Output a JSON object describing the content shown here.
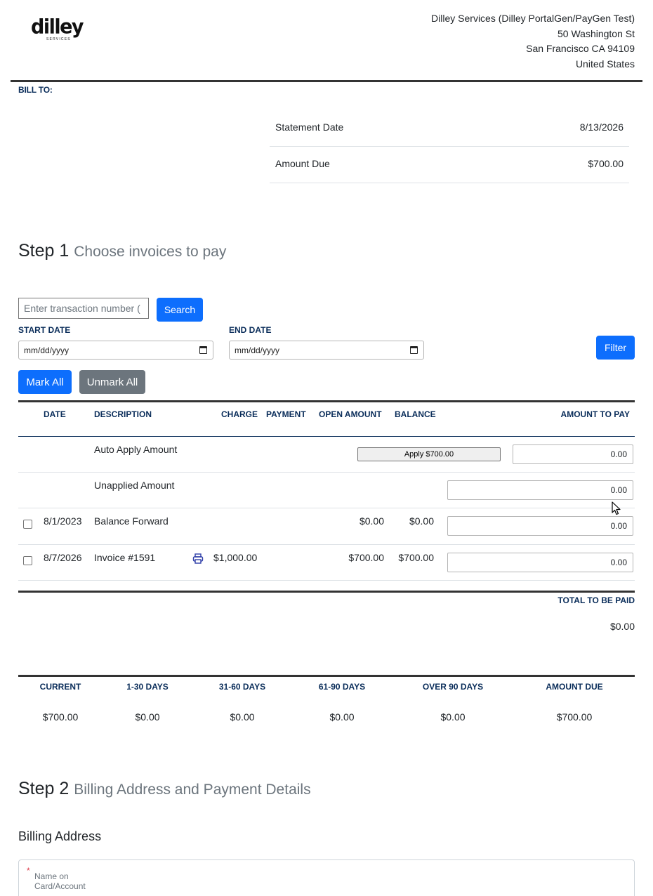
{
  "header": {
    "logo_text": "dilley",
    "logo_sub": "SERVICES",
    "company_lines": [
      "Dilley Services (Dilley PortalGen/PayGen Test)",
      "50 Washington St",
      "San Francisco CA 94109",
      "United States"
    ],
    "bill_to": "BILL TO:"
  },
  "statement": {
    "date_label": "Statement Date",
    "date_value": "8/13/2026",
    "due_label": "Amount Due",
    "due_value": "$700.00"
  },
  "step1": {
    "step": "Step 1",
    "title": "Choose invoices to pay",
    "search_placeholder": "Enter transaction number (",
    "search_button": "Search",
    "start_date_label": "START DATE",
    "end_date_label": "END DATE",
    "date_placeholder": "mm/dd/yyyy",
    "filter_button": "Filter",
    "mark_all": "Mark All",
    "unmark_all": "Unmark All"
  },
  "table": {
    "headers": [
      "DATE",
      "DESCRIPTION",
      "CHARGE",
      "PAYMENT",
      "OPEN AMOUNT",
      "BALANCE",
      "AMOUNT TO PAY"
    ],
    "auto_apply_label": "Auto Apply Amount",
    "apply_button": "Apply $700.00",
    "auto_apply_value": "0.00",
    "unapplied_label": "Unapplied Amount",
    "unapplied_value": "0.00",
    "rows": [
      {
        "date": "8/1/2023",
        "description": "Balance Forward",
        "charge": "",
        "payment": "",
        "open_amount": "$0.00",
        "balance": "$0.00",
        "amount_to_pay": "0.00"
      },
      {
        "date": "8/7/2026",
        "description": "Invoice #1591",
        "charge": "$1,000.00",
        "payment": "",
        "open_amount": "$700.00",
        "balance": "$700.00",
        "amount_to_pay": "0.00"
      }
    ],
    "total_label": "TOTAL TO BE PAID",
    "total_value": "$0.00"
  },
  "aging": {
    "headers": [
      "CURRENT",
      "1-30 DAYS",
      "31-60 DAYS",
      "61-90 DAYS",
      "OVER 90 DAYS",
      "AMOUNT DUE"
    ],
    "values": [
      "$700.00",
      "$0.00",
      "$0.00",
      "$0.00",
      "$0.00",
      "$700.00"
    ]
  },
  "step2": {
    "step": "Step 2",
    "title": "Billing Address and Payment Details",
    "billing_heading": "Billing Address",
    "name_label": "Name on Card/Account",
    "required_mark": "*"
  },
  "colors": {
    "primary": "#0d6efd",
    "secondary": "#6c757d",
    "header_navy": "#0a2d5a",
    "required": "#dc3545"
  }
}
